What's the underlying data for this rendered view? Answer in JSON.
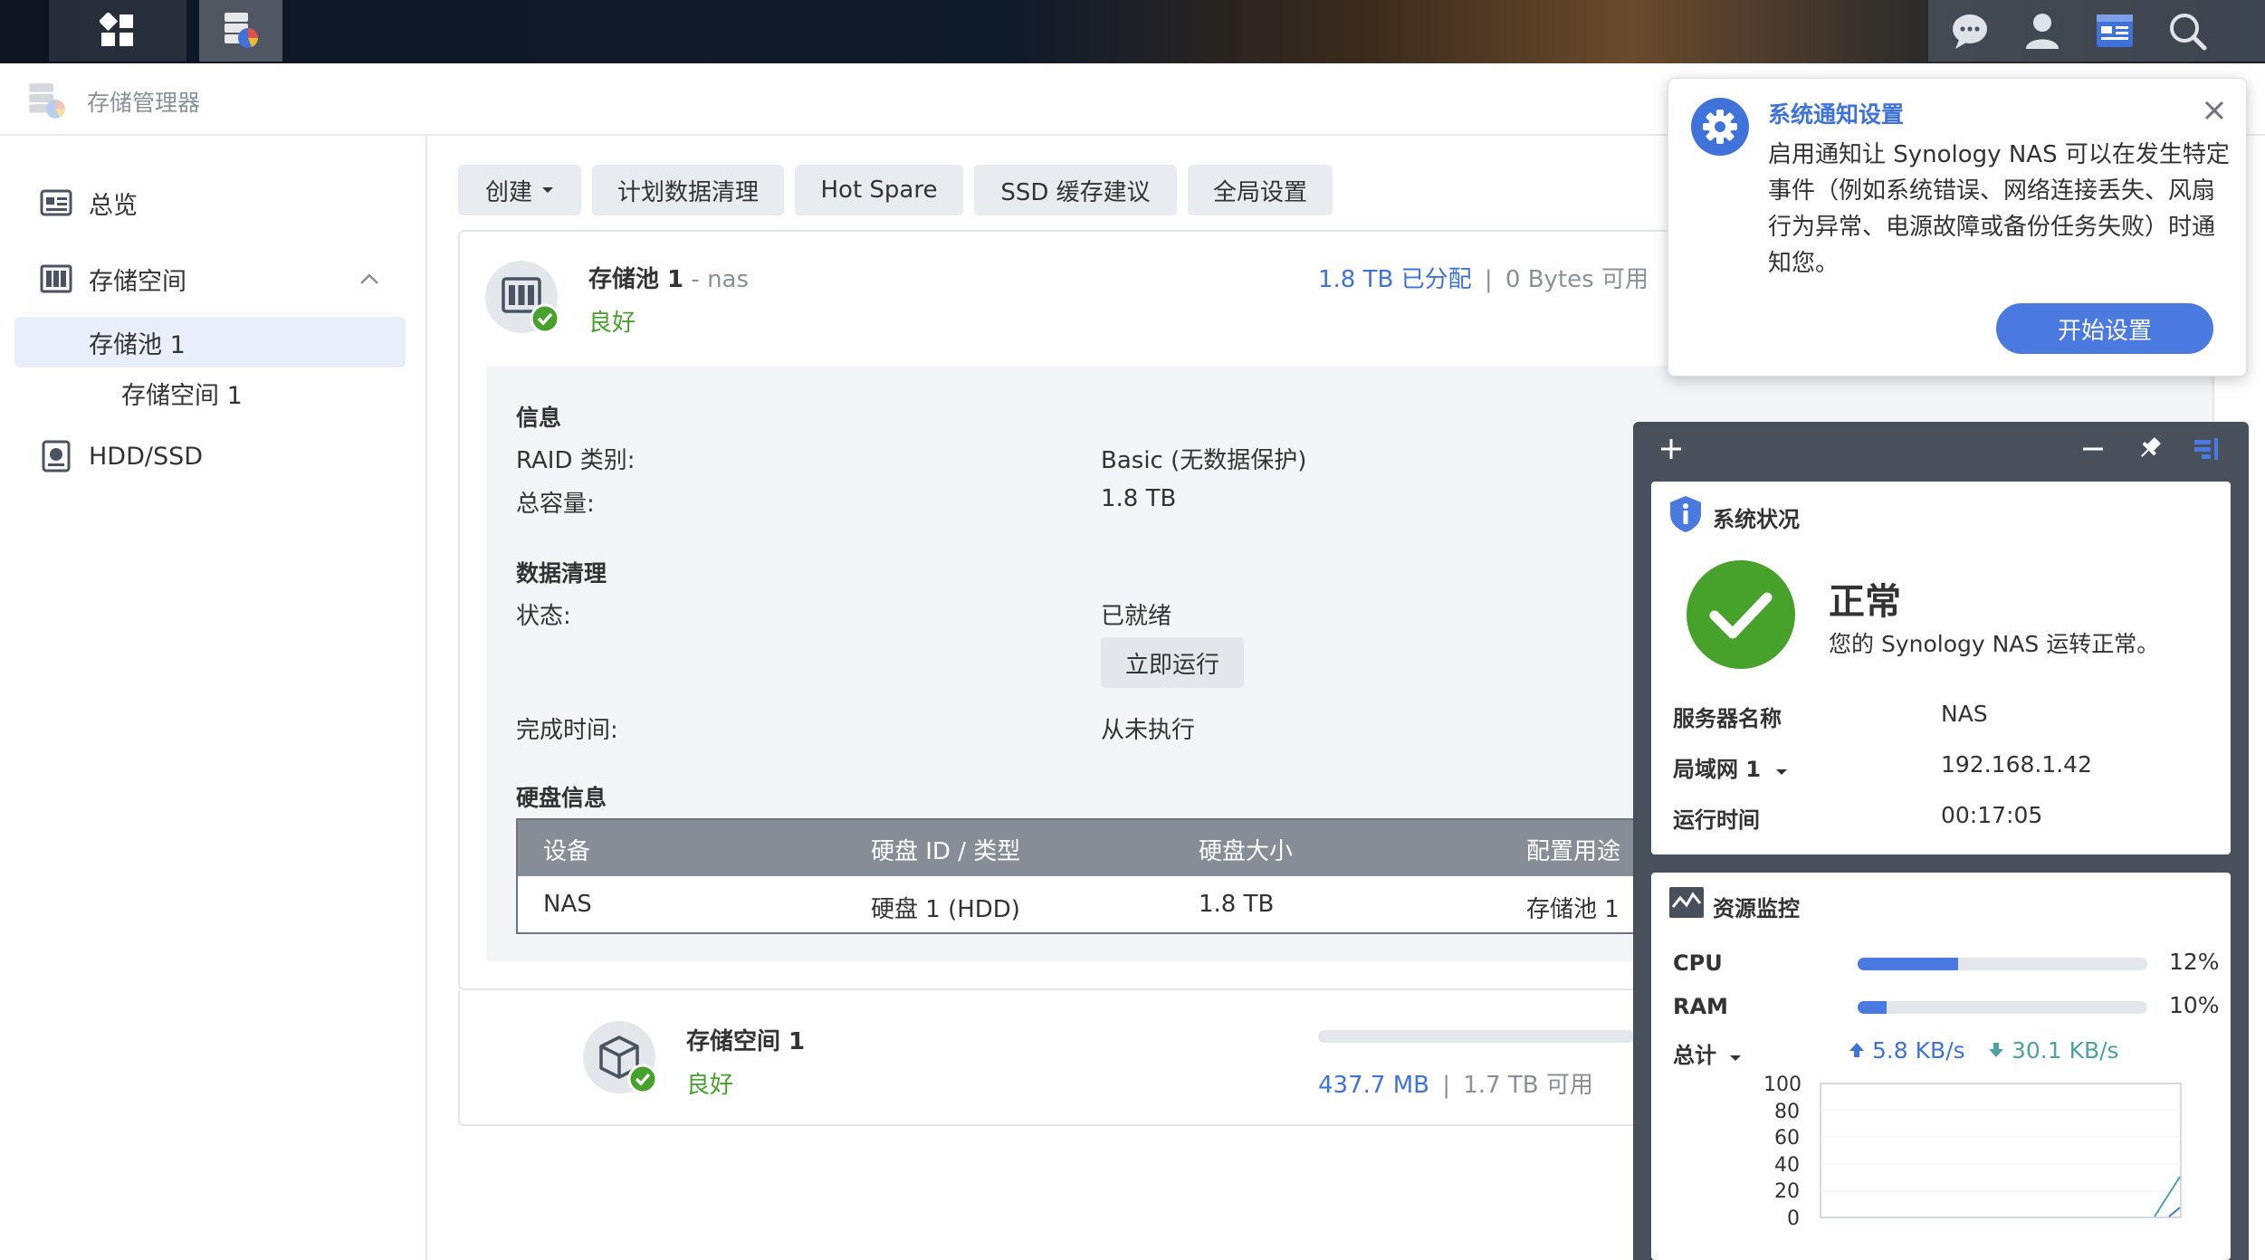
{
  "app": {
    "title": "存储管理器"
  },
  "sidebar": {
    "items": [
      {
        "label": "总览"
      },
      {
        "label": "存储空间"
      },
      {
        "label": "存储池 1"
      },
      {
        "label": "存储空间 1"
      },
      {
        "label": "HDD/SSD"
      }
    ]
  },
  "toolbar": {
    "create": "创建",
    "schedule_scrub": "计划数据清理",
    "hot_spare": "Hot Spare",
    "ssd_cache": "SSD 缓存建议",
    "global_settings": "全局设置"
  },
  "pool": {
    "name": "存储池 1",
    "separator": " - ",
    "host": "nas",
    "status": "良好",
    "allocated": "1.8 TB 已分配",
    "divider": "|",
    "available": "0 Bytes 可用",
    "info_heading": "信息",
    "raid_label": "RAID 类别:",
    "raid_value": "Basic (无数据保护)",
    "capacity_label": "总容量:",
    "capacity_value": "1.8 TB",
    "scrub_heading": "数据清理",
    "scrub_status_label": "状态:",
    "scrub_status_value": "已就绪",
    "run_now": "立即运行",
    "finish_label": "完成时间:",
    "finish_value": "从未执行",
    "disk_heading": "硬盘信息",
    "table": {
      "headers": [
        "设备",
        "硬盘 ID / 类型",
        "硬盘大小",
        "配置用途"
      ],
      "rows": [
        [
          "NAS",
          "硬盘 1 (HDD)",
          "1.8 TB",
          "存储池 1"
        ]
      ]
    }
  },
  "volume": {
    "name": "存储空间 1",
    "status": "良好",
    "used": "437.7 MB",
    "divider": "|",
    "available": "1.7 TB 可用"
  },
  "notification": {
    "title": "系统通知设置",
    "body": "启用通知让 Synology NAS 可以在发生特定事件（例如系统错误、网络连接丢失、风扇行为异常、电源故障或备份任务失败）时通知您。",
    "button": "开始设置"
  },
  "system_status": {
    "title": "系统状况",
    "state": "正常",
    "message": "您的 Synology NAS 运转正常。",
    "rows": [
      {
        "label": "服务器名称",
        "value": "NAS"
      },
      {
        "label": "局域网 1",
        "value": "192.168.1.42"
      },
      {
        "label": "运行时间",
        "value": "00:17:05"
      }
    ]
  },
  "resource_monitor": {
    "title": "资源监控",
    "cpu_label": "CPU",
    "cpu_value": "12%",
    "cpu_fraction": 0.12,
    "ram_label": "RAM",
    "ram_value": "10%",
    "ram_fraction": 0.1,
    "total_label": "总计",
    "upload": "5.8 KB/s",
    "download": "30.1 KB/s",
    "chart_ticks": [
      "100",
      "80",
      "60",
      "40",
      "20",
      "0"
    ]
  },
  "colors": {
    "accent": "#4a79e0",
    "good": "#47a22c",
    "link": "#3f73d9",
    "widget_bg": "#48505c",
    "meter_fill": "#4a79e0",
    "net_up": "#3f73d9",
    "net_down": "#4aa3a0"
  }
}
